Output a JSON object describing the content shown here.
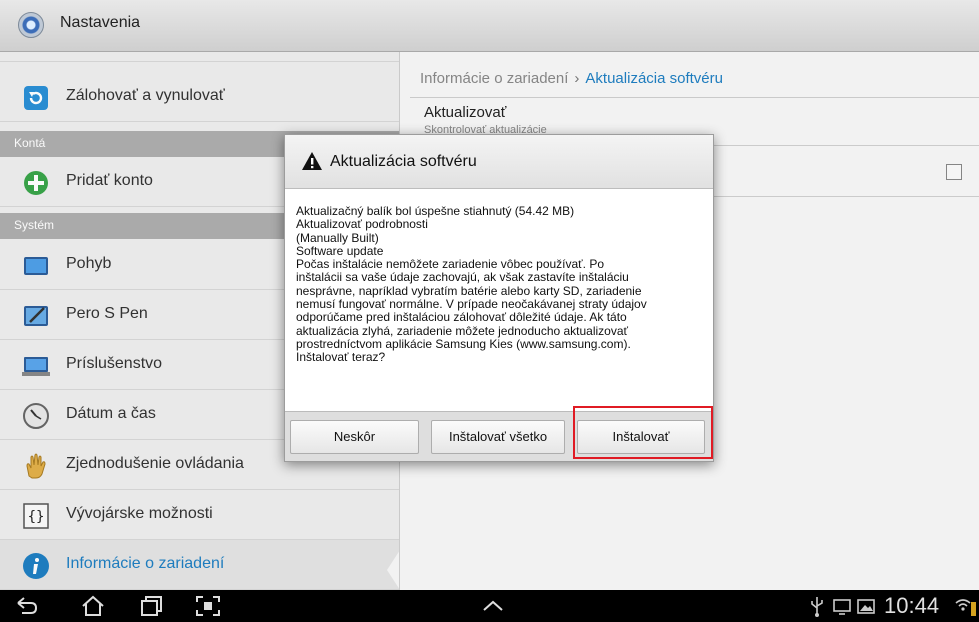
{
  "app_bar": {
    "title": "Nastavenia",
    "icon": "settings-app-icon"
  },
  "sidebar": {
    "items": [
      {
        "label": "Zálohovať a vynulovať",
        "icon": "backup-restore-icon"
      },
      {
        "label": "Pridať konto",
        "icon": "add-account-icon"
      },
      {
        "label": "Pohyb",
        "icon": "motion-icon"
      },
      {
        "label": "Pero S Pen",
        "icon": "s-pen-icon"
      },
      {
        "label": "Príslušenstvo",
        "icon": "accessory-icon"
      },
      {
        "label": "Dátum a čas",
        "icon": "clock-icon"
      },
      {
        "label": "Zjednodušenie ovládania",
        "icon": "accessibility-hand-icon"
      },
      {
        "label": "Vývojárske možnosti",
        "icon": "developer-braces-icon"
      },
      {
        "label": "Informácie o zariadení",
        "icon": "info-icon"
      }
    ],
    "sections": {
      "accounts": "Kontá",
      "system": "Systém"
    }
  },
  "detail": {
    "breadcrumb": {
      "parent": "Informácie o zariadení",
      "separator": "›",
      "current": "Aktualizácia softvéru"
    },
    "pref": {
      "title": "Aktualizovať",
      "subtitle": "Skontrolovať aktualizácie"
    }
  },
  "dialog": {
    "title": "Aktualizácia softvéru",
    "lines": [
      "Aktualizačný balík bol úspešne stiahnutý (54.42 MB)",
      "Aktualizovať podrobnosti",
      "(Manually Built)",
      "Software update",
      "Počas inštalácie nemôžete zariadenie vôbec používať. Po",
      "inštalácii sa vaše údaje zachovajú, ak však zastavíte inštaláciu",
      "nesprávne, napríklad vybratím batérie alebo karty SD, zariadenie",
      "nemusí fungovať normálne. V prípade neočakávanej straty údajov",
      "odporúčame pred inštaláciou zálohovať dôležité údaje. Ak táto",
      "aktualizácia zlyhá, zariadenie môžete jednoducho aktualizovať",
      "prostredníctvom aplikácie Samsung Kies (www.samsung.com).",
      "Inštalovať teraz?"
    ],
    "buttons": {
      "later": "Neskôr",
      "install_all": "Inštalovať všetko",
      "install": "Inštalovať"
    }
  },
  "status_bar": {
    "time": "10:44"
  },
  "colors": {
    "accent": "#1f7fc2",
    "highlight": "#e01b24",
    "section": "#aeaeae"
  }
}
